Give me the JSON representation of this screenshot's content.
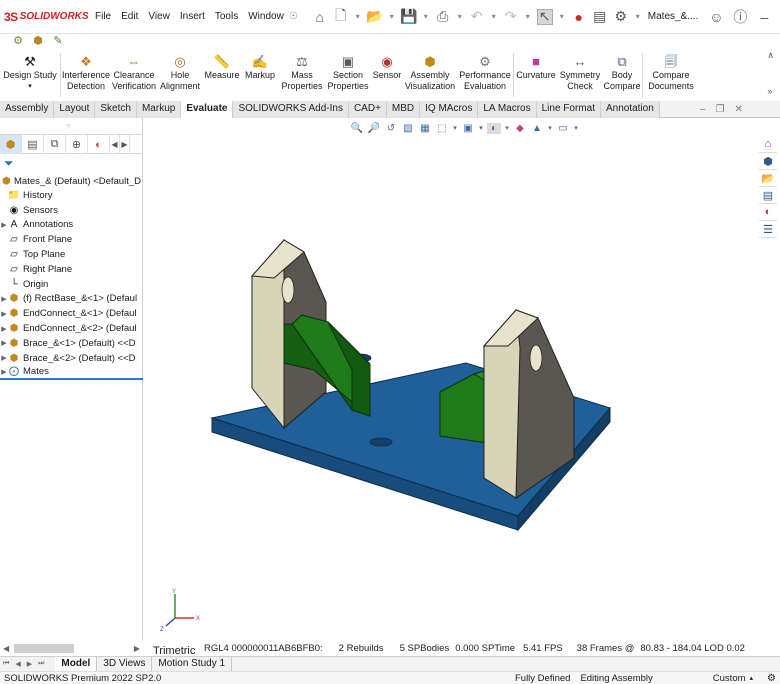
{
  "title_bar": {
    "logo_prefix": "3S",
    "logo_text": "SOLIDWORKS",
    "menus": [
      "File",
      "Edit",
      "View",
      "Insert",
      "Tools",
      "Window"
    ],
    "pin_icon": "pin-icon",
    "document_title": "Mates_&...."
  },
  "ribbon": {
    "items": [
      {
        "label": "Design Study",
        "icon": "design-study-icon"
      },
      {
        "label": "Interference Detection",
        "icon": "interference-icon"
      },
      {
        "label": "Clearance Verification",
        "icon": "clearance-icon"
      },
      {
        "label": "Hole Alignment",
        "icon": "hole-alignment-icon"
      },
      {
        "label": "Measure",
        "icon": "measure-icon"
      },
      {
        "label": "Markup",
        "icon": "markup-icon"
      },
      {
        "label": "Mass Properties",
        "icon": "mass-properties-icon"
      },
      {
        "label": "Section Properties",
        "icon": "section-properties-icon"
      },
      {
        "label": "Sensor",
        "icon": "sensor-icon"
      },
      {
        "label": "Assembly Visualization",
        "icon": "assembly-visualization-icon"
      },
      {
        "label": "Performance Evaluation",
        "icon": "performance-icon"
      },
      {
        "label": "Curvature",
        "icon": "curvature-icon"
      },
      {
        "label": "Symmetry Check",
        "icon": "symmetry-icon"
      },
      {
        "label": "Body Compare",
        "icon": "body-compare-icon"
      },
      {
        "label": "Compare Documents",
        "icon": "compare-documents-icon"
      }
    ]
  },
  "tabs": [
    "Assembly",
    "Layout",
    "Sketch",
    "Markup",
    "Evaluate",
    "SOLIDWORKS Add-Ins",
    "CAD+",
    "MBD",
    "IQ MAcros",
    "LA Macros",
    "Line Format",
    "Annotation"
  ],
  "active_tab": "Evaluate",
  "feature_tree": {
    "root": "Mates_& (Default) <Default_D",
    "nodes": [
      {
        "label": "History",
        "icon": "history-folder-icon",
        "expandable": false
      },
      {
        "label": "Sensors",
        "icon": "sensors-icon",
        "expandable": false
      },
      {
        "label": "Annotations",
        "icon": "annotations-icon",
        "expandable": true
      },
      {
        "label": "Front Plane",
        "icon": "plane-icon",
        "expandable": false
      },
      {
        "label": "Top Plane",
        "icon": "plane-icon",
        "expandable": false
      },
      {
        "label": "Right Plane",
        "icon": "plane-icon",
        "expandable": false
      },
      {
        "label": "Origin",
        "icon": "origin-icon",
        "expandable": false
      },
      {
        "label": "(f) RectBase_&<1> (Defaul",
        "icon": "part-icon",
        "expandable": true
      },
      {
        "label": "EndConnect_&<1> (Defaul",
        "icon": "part-icon",
        "expandable": true
      },
      {
        "label": "EndConnect_&<2> (Defaul",
        "icon": "part-icon",
        "expandable": true
      },
      {
        "label": "Brace_&<1> (Default) <<D",
        "icon": "part-icon",
        "expandable": true
      },
      {
        "label": "Brace_&<2> (Default) <<D",
        "icon": "part-icon",
        "expandable": true
      },
      {
        "label": "Mates",
        "icon": "mates-icon",
        "expandable": true
      }
    ]
  },
  "viewport": {
    "view_label": "Trimetric",
    "triad_axes": [
      "X",
      "Y",
      "Z"
    ]
  },
  "info_bar": {
    "build": "RGL4 000000011AB6BFB0:",
    "rebuilds": "2 Rebuilds",
    "sp_bodies": "5 SPBodies",
    "sp_time": "0.000 SPTime",
    "fps": "5.41 FPS",
    "frames": "38 Frames @",
    "lod": "80.83 - 184.04 LOD 0.02"
  },
  "bottom_tabs": [
    "Model",
    "3D Views",
    "Motion Study 1"
  ],
  "active_bottom_tab": "Model",
  "status_bar": {
    "product": "SOLIDWORKS Premium 2022 SP2.0",
    "definition": "Fully Defined",
    "mode": "Editing Assembly",
    "units": "Custom"
  },
  "colors": {
    "base_plate": "#1f5f9a",
    "brace": "#1f7a1a",
    "end_connect": "#d8d4b8",
    "accent": "#2a7ad3"
  }
}
